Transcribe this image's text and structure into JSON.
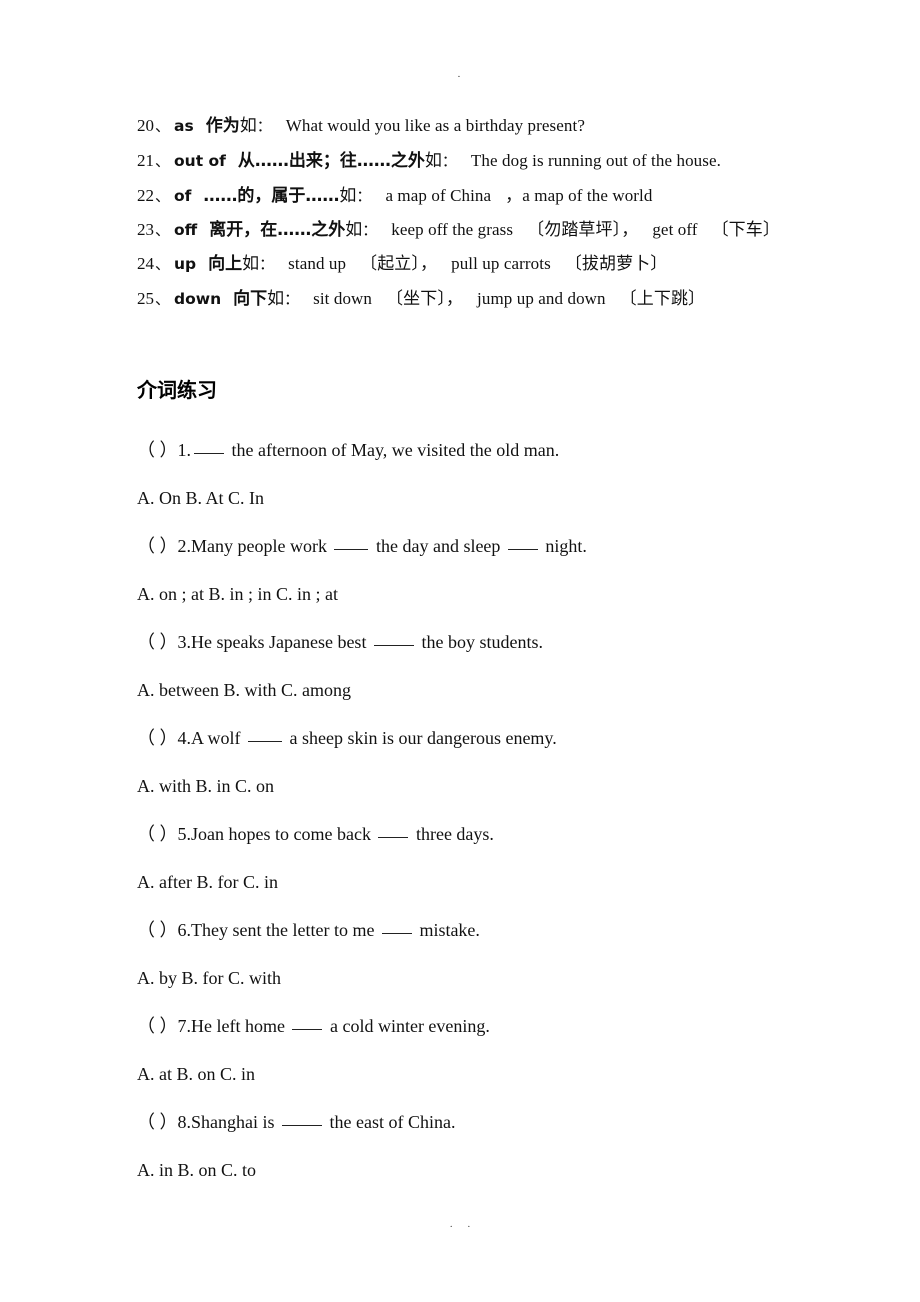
{
  "page": {
    "header_mark": "·",
    "footer_mark": "··"
  },
  "definitions": [
    {
      "num": "20",
      "sep": "、",
      "word": "as",
      "cn": "作为",
      "ru": "如",
      "colon": "：",
      "example": "What would you like as a birthday present?"
    },
    {
      "num": "21",
      "sep": "、",
      "word": "out of",
      "cn": "从……出来；往……之外",
      "ru": "如",
      "colon": "：",
      "example": "The dog is running out of the house."
    },
    {
      "num": "22",
      "sep": "、",
      "word": "of",
      "cn": "……的，属于……",
      "ru": "如",
      "colon": "：",
      "example": "a map of China",
      "example2": "，a map of the world"
    },
    {
      "num": "23",
      "sep": "、",
      "word": "off",
      "cn": "离开，在……之外",
      "ru": "如",
      "colon": "：",
      "example": "keep off the grass",
      "note1": "〔勿踏草坪〕，",
      "example2": "get off",
      "note2": "〔下车〕"
    },
    {
      "num": "24",
      "sep": "、",
      "word": "up",
      "cn": "向上",
      "ru": "如",
      "colon": "：",
      "example": "stand up",
      "note1": "〔起立〕，",
      "example2": "pull up carrots",
      "note2": "〔拔胡萝卜〕"
    },
    {
      "num": "25",
      "sep": "、",
      "word": "down",
      "cn": "向下",
      "ru": "如",
      "colon": "：",
      "example": "sit down",
      "note1": "〔坐下〕，",
      "example2": "jump up and down",
      "note2": "〔上下跳〕"
    }
  ],
  "quiz": {
    "heading": "介词练习",
    "questions": [
      {
        "marker": "（ ）",
        "number": "1.",
        "stem_pre": "",
        "stem_mid": " the afternoon of May, we visited the old man.",
        "stem_post": "",
        "options": "A.  On B.  At C.  In"
      },
      {
        "marker": "（ ）",
        "number": "2.",
        "stem_pre": "Many people work ",
        "stem_mid": " the day and sleep ",
        "stem_post": " night.",
        "options": "A.  on ; at B.  in ; in C.  in ; at"
      },
      {
        "marker": "（ ）",
        "number": "3.",
        "stem_pre": "He speaks Japanese best ",
        "stem_mid": " the boy students.",
        "stem_post": "",
        "options": "A.  between B.  with C.  among"
      },
      {
        "marker": "（ ）",
        "number": "4.",
        "stem_pre": "A wolf ",
        "stem_mid": " a sheep skin is our dangerous enemy.",
        "stem_post": "",
        "options": "A. with B.  in C.  on"
      },
      {
        "marker": "（ ）",
        "number": "5.",
        "stem_pre": "Joan hopes to come back ",
        "stem_mid": " three days.",
        "stem_post": "",
        "options": "A.  after B.  for C.  in"
      },
      {
        "marker": "（ ）",
        "number": "6.",
        "stem_pre": "They sent the letter to me ",
        "stem_mid": " mistake.",
        "stem_post": "",
        "options": "A.  by B.  for C.  with"
      },
      {
        "marker": "（ ）",
        "number": "7.",
        "stem_pre": "He left home ",
        "stem_mid": " a cold winter evening.",
        "stem_post": "",
        "options": "A.  at B.  on C.  in"
      },
      {
        "marker": "（ ）",
        "number": "8.",
        "stem_pre": "Shanghai is ",
        "stem_mid": " the east of China.",
        "stem_post": "",
        "options": "A.  in B.  on C.  to"
      }
    ]
  }
}
